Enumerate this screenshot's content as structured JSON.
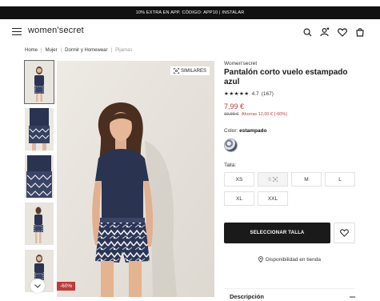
{
  "promo": {
    "text": "10% EXTRA EN APP. CÓDIGO: APP10 | INSTALAR"
  },
  "header": {
    "logo": "women'secret",
    "icons": [
      "menu-icon",
      "search-icon",
      "user-icon",
      "heart-icon",
      "bag-icon"
    ]
  },
  "breadcrumb": {
    "items": [
      "Home",
      "Mujer",
      "Dormir y Homewear",
      "Pijamas"
    ],
    "separator": "|"
  },
  "gallery": {
    "similares": "SIMILARES",
    "discount": "-60%"
  },
  "product": {
    "brand": "Women'secret",
    "title": "Pantalón corto vuelo estampado azul",
    "stars": "★★★★★",
    "rating": "4.7",
    "reviews": "(167)",
    "price": "7,99 €",
    "old_price": "19,99 €",
    "saving": "Ahorras 12,00 € (-60%)",
    "color_label": "Color:",
    "color_value": "estampado",
    "size_label": "Talla:",
    "sizes": [
      "XS",
      "S",
      "M",
      "L",
      "XL",
      "XXL"
    ],
    "cta": "SELECCIONAR TALLA",
    "availability": "Disponibilidad en tienda",
    "description": "Descripción"
  },
  "colors": {
    "accent": "#c0393b",
    "dark": "#1a1a1a",
    "garment_top": "#2a3350"
  }
}
